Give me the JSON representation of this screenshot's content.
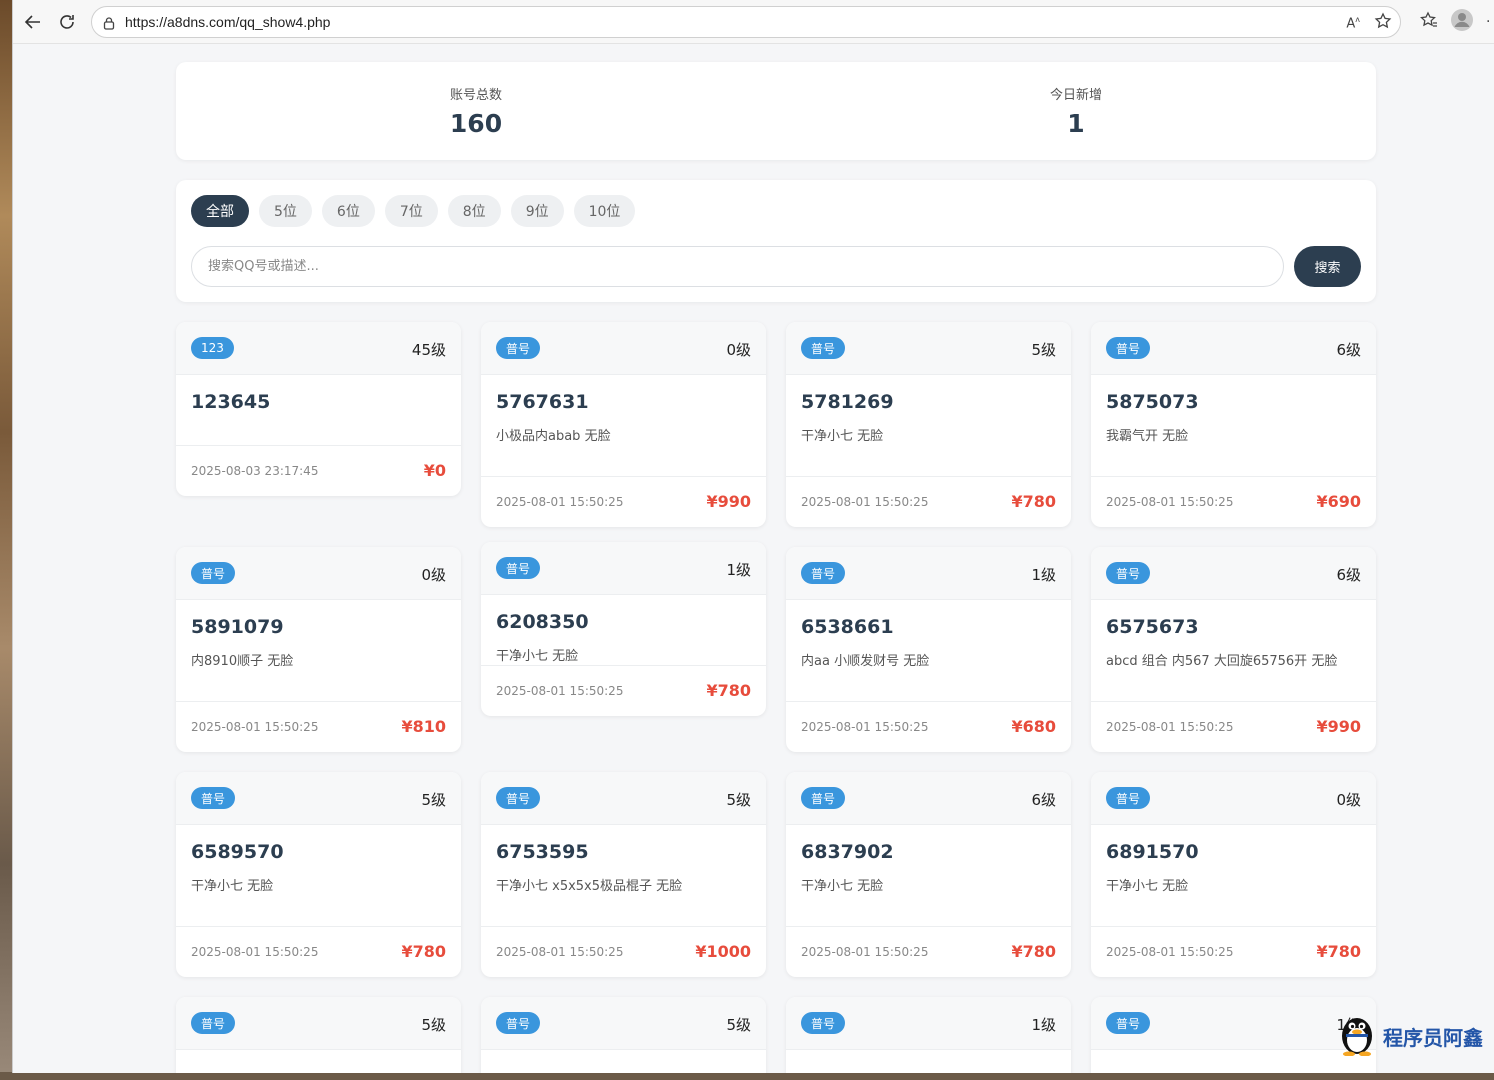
{
  "browser": {
    "url": "https://a8dns.com/qq_show4.php"
  },
  "stats": [
    {
      "label": "账号总数",
      "value": "160"
    },
    {
      "label": "今日新增",
      "value": "1"
    }
  ],
  "filters": [
    "全部",
    "5位",
    "6位",
    "7位",
    "8位",
    "9位",
    "10位"
  ],
  "search": {
    "placeholder": "搜索QQ号或描述...",
    "button": "搜索"
  },
  "cards": [
    {
      "badge": "123",
      "level": "45级",
      "qq": "123645",
      "desc": "",
      "date": "2025-08-03 23:17:45",
      "price": "¥0"
    },
    {
      "badge": "普号",
      "level": "0级",
      "qq": "5767631",
      "desc": "小极品内abab 无脸",
      "date": "2025-08-01 15:50:25",
      "price": "¥990"
    },
    {
      "badge": "普号",
      "level": "5级",
      "qq": "5781269",
      "desc": "干净小七 无脸",
      "date": "2025-08-01 15:50:25",
      "price": "¥780"
    },
    {
      "badge": "普号",
      "level": "6级",
      "qq": "5875073",
      "desc": "我霸气开 无脸",
      "date": "2025-08-01 15:50:25",
      "price": "¥690"
    },
    {
      "badge": "普号",
      "level": "0级",
      "qq": "5891079",
      "desc": "内8910顺子 无脸",
      "date": "2025-08-01 15:50:25",
      "price": "¥810"
    },
    {
      "badge": "普号",
      "level": "1级",
      "qq": "6208350",
      "desc": "干净小七 无脸",
      "date": "2025-08-01 15:50:25",
      "price": "¥780"
    },
    {
      "badge": "普号",
      "level": "1级",
      "qq": "6538661",
      "desc": "内aa 小顺发财号 无脸",
      "date": "2025-08-01 15:50:25",
      "price": "¥680"
    },
    {
      "badge": "普号",
      "level": "6级",
      "qq": "6575673",
      "desc": "abcd 组合 内567 大回旋65756开 无脸",
      "date": "2025-08-01 15:50:25",
      "price": "¥990"
    },
    {
      "badge": "普号",
      "level": "5级",
      "qq": "6589570",
      "desc": "干净小七 无脸",
      "date": "2025-08-01 15:50:25",
      "price": "¥780"
    },
    {
      "badge": "普号",
      "level": "5级",
      "qq": "6753595",
      "desc": "干净小七 x5x5x5极品棍子 无脸",
      "date": "2025-08-01 15:50:25",
      "price": "¥1000"
    },
    {
      "badge": "普号",
      "level": "6级",
      "qq": "6837902",
      "desc": "干净小七 无脸",
      "date": "2025-08-01 15:50:25",
      "price": "¥780"
    },
    {
      "badge": "普号",
      "level": "0级",
      "qq": "6891570",
      "desc": "干净小七 无脸",
      "date": "2025-08-01 15:50:25",
      "price": "¥780"
    },
    {
      "badge": "普号",
      "level": "5级"
    },
    {
      "badge": "普号",
      "level": "5级"
    },
    {
      "badge": "普号",
      "level": "1级"
    },
    {
      "badge": "普号",
      "level": "1级"
    }
  ],
  "watermark": "程序员阿鑫"
}
